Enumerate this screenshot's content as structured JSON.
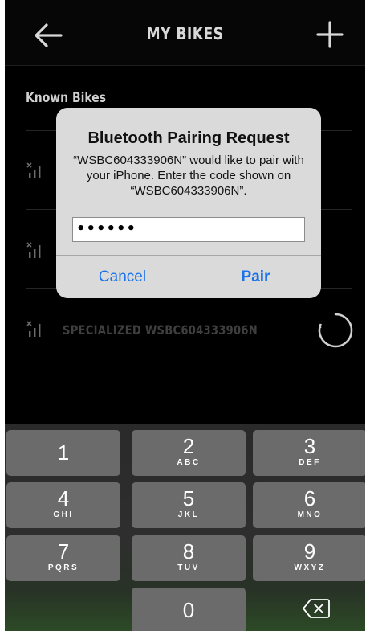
{
  "navbar": {
    "title": "MY BIKES",
    "back_icon": "arrow-left-icon",
    "add_icon": "plus-icon"
  },
  "content": {
    "section_header": "Known Bikes",
    "bikes": [
      {
        "name": "",
        "signal_icon": "signal-icon"
      },
      {
        "name": "",
        "signal_icon": "signal-icon"
      },
      {
        "name": "SPECIALIZED WSBC604333906N",
        "signal_icon": "signal-icon",
        "status_icon": "loading-spinner-icon"
      }
    ]
  },
  "alert": {
    "title": "Bluetooth Pairing Request",
    "message": "“WSBC604333906N” would like to pair with your iPhone. Enter the code shown on “WSBC604333906N”.",
    "code_value": "••••••",
    "cancel_label": "Cancel",
    "pair_label": "Pair"
  },
  "keypad": {
    "keys": [
      {
        "num": "1",
        "letters": ""
      },
      {
        "num": "2",
        "letters": "ABC"
      },
      {
        "num": "3",
        "letters": "DEF"
      },
      {
        "num": "4",
        "letters": "GHI"
      },
      {
        "num": "5",
        "letters": "JKL"
      },
      {
        "num": "6",
        "letters": "MNO"
      },
      {
        "num": "7",
        "letters": "PQRS"
      },
      {
        "num": "8",
        "letters": "TUV"
      },
      {
        "num": "9",
        "letters": "WXYZ"
      },
      {
        "num": "0",
        "letters": ""
      }
    ],
    "delete_icon": "backspace-icon"
  },
  "colors": {
    "accent": "#1a73e8",
    "background": "#000000",
    "key": "#6b6b6b"
  }
}
